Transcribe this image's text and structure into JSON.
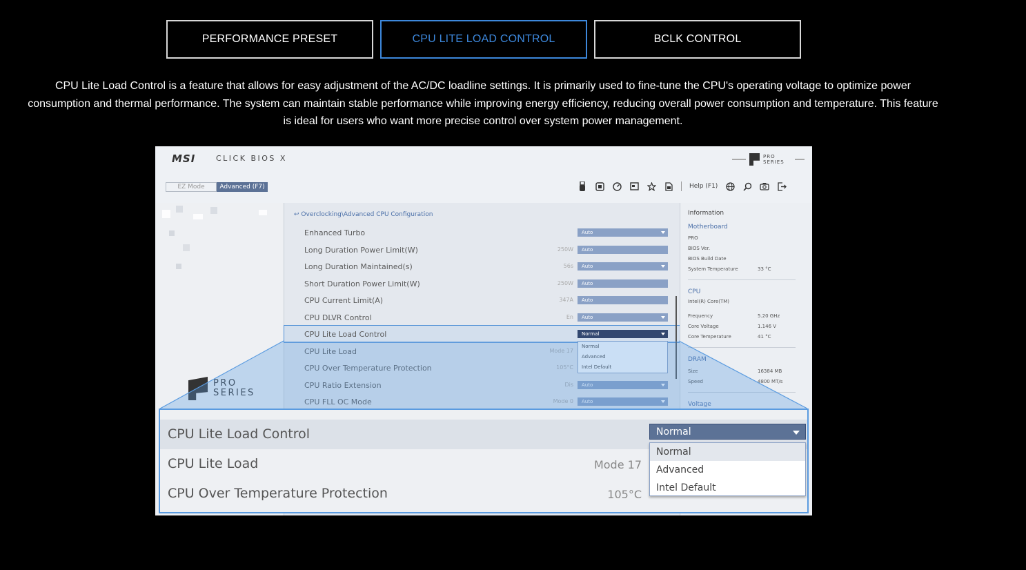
{
  "tabs": [
    {
      "label": "PERFORMANCE PRESET"
    },
    {
      "label": "CPU LITE LOAD CONTROL"
    },
    {
      "label": "BCLK CONTROL"
    }
  ],
  "description": "CPU Lite Load Control is a feature that allows for easy adjustment of the AC/DC loadline settings. It is primarily used to fine-tune the CPU's operating voltage to optimize power consumption and thermal performance. The system can maintain stable performance while improving energy efficiency, reducing overall power consumption and temperature. This feature is ideal for users who want more precise control over system power management.",
  "bios": {
    "brand": "MSI",
    "product": "CLICK BIOS X",
    "series_badge": "PRO\nSERIES",
    "ez_mode": "EZ Mode",
    "advanced_mode": "Advanced (F7)",
    "help": "Help (F1)",
    "left_logo": "PRO\nSERIES",
    "breadcrumb": "Overclocking\\Advanced CPU Configuration",
    "rows": [
      {
        "label": "Enhanced Turbo",
        "value": "",
        "option": "Auto"
      },
      {
        "label": "Long Duration Power Limit(W)",
        "value": "250W",
        "option": "Auto"
      },
      {
        "label": "Long Duration Maintained(s)",
        "value": "56s",
        "option": "Auto"
      },
      {
        "label": "Short Duration Power Limit(W)",
        "value": "250W",
        "option": "Auto"
      },
      {
        "label": "CPU Current Limit(A)",
        "value": "347A",
        "option": "Auto"
      },
      {
        "label": "CPU DLVR Control",
        "value": "En",
        "option": "Auto"
      },
      {
        "label": "CPU Lite Load Control",
        "value": "",
        "option": "Normal"
      },
      {
        "label": "CPU Lite Load",
        "value": "Mode 17",
        "option": ""
      },
      {
        "label": "CPU Over Temperature Protection",
        "value": "105°C",
        "option": ""
      },
      {
        "label": "CPU Ratio Extension",
        "value": "Dis",
        "option": "Auto"
      },
      {
        "label": "CPU FLL OC Mode",
        "value": "Mode 0",
        "option": "Auto"
      }
    ],
    "mini_options": [
      "Normal",
      "Advanced",
      "Intel Default"
    ],
    "info": {
      "title": "Information",
      "motherboard_title": "Motherboard",
      "motherboard_name": "PRO",
      "bios_ver": "BIOS Ver.",
      "bios_build": "BIOS Build Date",
      "sys_temp_label": "System Temperature",
      "sys_temp": "33 °C",
      "cpu_title": "CPU",
      "cpu_name": "Intel(R) Core(TM)",
      "freq_label": "Frequency",
      "freq": "5.20 GHz",
      "volt_label": "Core Voltage",
      "volt": "1.146 V",
      "core_temp_label": "Core Temperature",
      "core_temp": "41 °C",
      "dram_title": "DRAM",
      "size_label": "Size",
      "size": "16384 MB",
      "speed_label": "Speed",
      "speed": "4800 MT/s",
      "voltage_title": "Voltage"
    },
    "zoom": {
      "row1_label": "CPU Lite Load Control",
      "row1_option": "Normal",
      "row2_label": "CPU Lite Load",
      "row2_value": "Mode 17",
      "row3_label": "CPU Over Temperature Protection",
      "row3_value": "105°C",
      "options": [
        "Normal",
        "Advanced",
        "Intel Default"
      ]
    }
  }
}
